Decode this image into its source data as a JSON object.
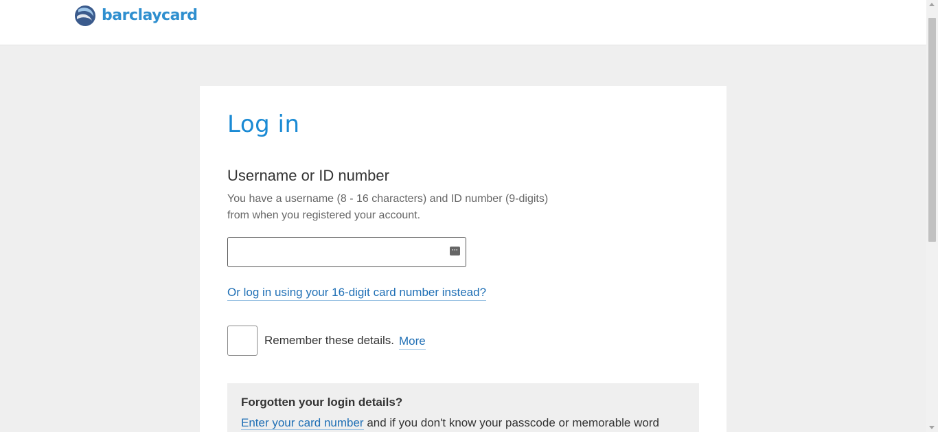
{
  "header": {
    "logo_text": "barclaycard"
  },
  "login": {
    "title": "Log in",
    "username_label": "Username or ID number",
    "help_text": "You have a username (8 - 16 characters) and ID number (9-digits) from when you registered your account.",
    "username_value": "",
    "card_number_link": "Or log in using your 16-digit card number instead?",
    "remember_label": "Remember these details.",
    "more_link": "More"
  },
  "forgotten": {
    "title": "Forgotten your login details?",
    "link_text": "Enter your card number",
    "text": " and if you don't know your passcode or memorable word"
  },
  "icons": {
    "logo": "barclaycard-logo",
    "password_manager": "password-manager-icon"
  },
  "colors": {
    "accent": "#1a8ad4",
    "link": "#1f6fb5",
    "background": "#efefef"
  }
}
